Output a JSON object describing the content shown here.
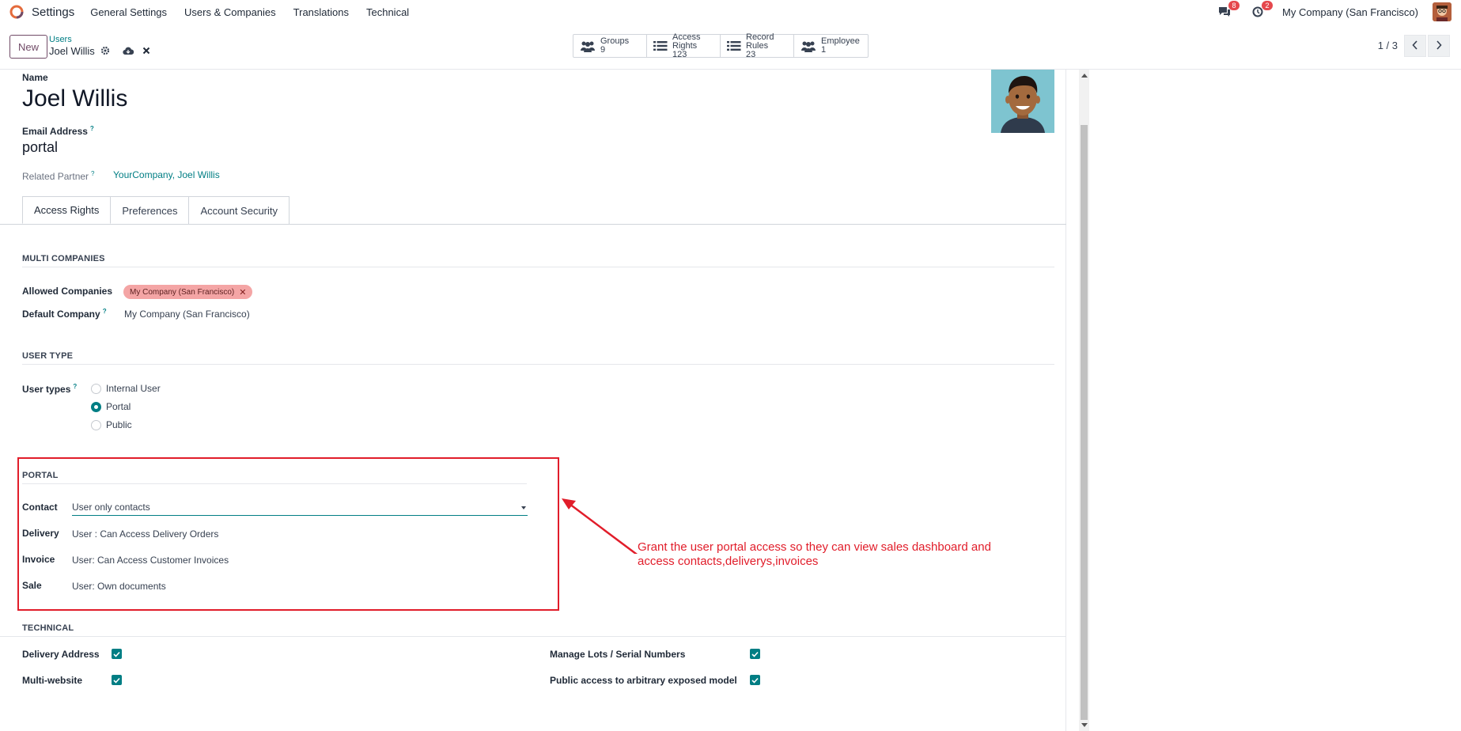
{
  "app": {
    "name": "Settings"
  },
  "menu": [
    "General Settings",
    "Users & Companies",
    "Translations",
    "Technical"
  ],
  "systray": {
    "messages_count": "8",
    "activities_count": "2",
    "company": "My Company (San Francisco)"
  },
  "control": {
    "new_label": "New",
    "breadcrumb_parent": "Users",
    "record_name": "Joel Willis",
    "pager": "1 / 3",
    "smart_buttons": [
      {
        "label": "Groups",
        "value": "9",
        "icon": "users-icon"
      },
      {
        "label": "Access Rights",
        "value": "123",
        "icon": "list-icon"
      },
      {
        "label": "Record Rules",
        "value": "23",
        "icon": "list-icon"
      },
      {
        "label": "Employee",
        "value": "1",
        "icon": "users-icon"
      }
    ]
  },
  "form": {
    "name_label": "Name",
    "name": "Joel Willis",
    "email_label": "Email Address",
    "email": "portal",
    "help_mark": "?",
    "partner_label": "Related Partner",
    "partner": "YourCompany, Joel Willis",
    "tabs": [
      "Access Rights",
      "Preferences",
      "Account Security"
    ],
    "active_tab": "Access Rights"
  },
  "multi_companies": {
    "title": "MULTI COMPANIES",
    "allowed_label": "Allowed Companies",
    "allowed_tag": "My Company (San Francisco)",
    "default_label": "Default Company",
    "default_value": "My Company (San Francisco)"
  },
  "user_type": {
    "title": "USER TYPE",
    "label": "User types",
    "options": [
      "Internal User",
      "Portal",
      "Public"
    ],
    "selected": "Portal"
  },
  "portal": {
    "title": "PORTAL",
    "contact_label": "Contact",
    "contact_value": "User only contacts",
    "delivery_label": "Delivery",
    "delivery_value": "User : Can Access Delivery Orders",
    "invoice_label": "Invoice",
    "invoice_value": "User: Can Access Customer Invoices",
    "sale_label": "Sale",
    "sale_value": "User: Own documents"
  },
  "technical": {
    "title": "TECHNICAL",
    "delivery_address": "Delivery Address",
    "multi_website": "Multi-website",
    "manage_lots": "Manage Lots / Serial Numbers",
    "public_access": "Public access to arbitrary exposed model"
  },
  "annotation": {
    "line1": "Grant the user portal access so they can view sales dashboard and",
    "line2": "access contacts,deliverys,invoices",
    "color": "#e11d2a"
  },
  "colors": {
    "accent": "#017e84",
    "brand": "#714b67",
    "tag": "#f4a5a5"
  }
}
